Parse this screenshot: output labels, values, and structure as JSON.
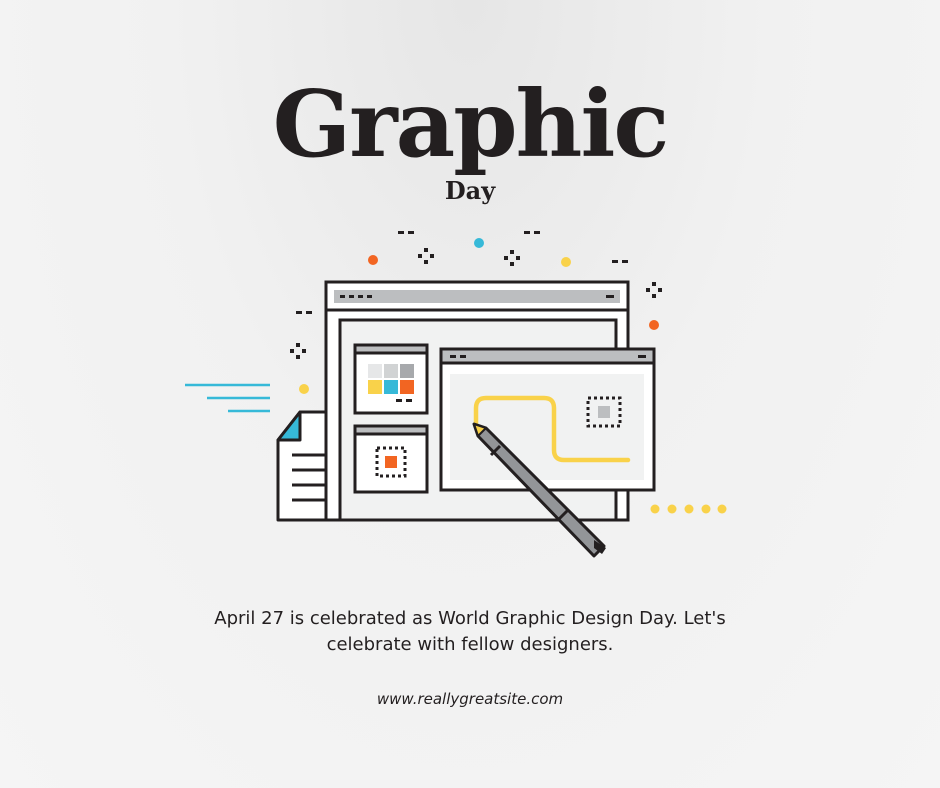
{
  "heading": {
    "title": "Graphic",
    "subtitle": "Day"
  },
  "body": {
    "description": "April 27 is celebrated as World Graphic Design Day. Let's celebrate with fellow designers.",
    "website": "www.reallygreatsite.com"
  },
  "illustration": {
    "icon": "design-window-with-stylus-icon"
  },
  "colors": {
    "ink": "#231f20",
    "accent_yellow": "#f9d24a",
    "accent_orange": "#f26522",
    "accent_blue": "#36b9d8",
    "panel_gray": "#bcbec0"
  }
}
